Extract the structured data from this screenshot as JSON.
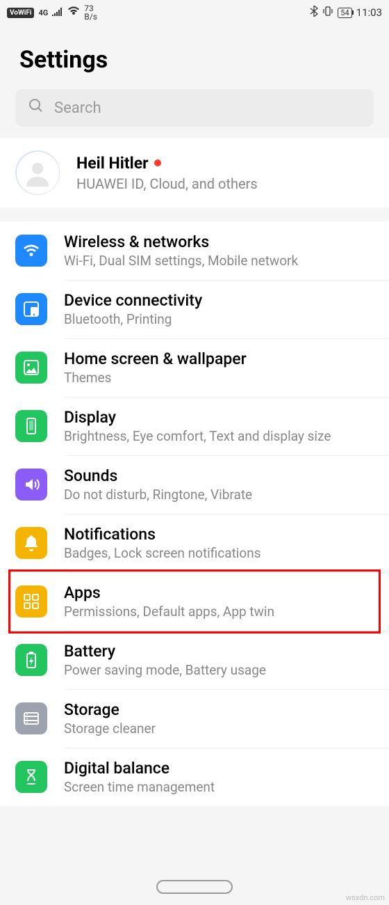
{
  "status": {
    "vowifi": "VoWiFi",
    "net": "4G",
    "speed_top": "73",
    "speed_bot": "B/s",
    "battery": "54",
    "time": "11:03"
  },
  "header": {
    "title": "Settings"
  },
  "search": {
    "placeholder": "Search"
  },
  "account": {
    "name": "Heil Hitler",
    "sub": "HUAWEI ID, Cloud, and others"
  },
  "items": [
    {
      "key": "wireless",
      "title": "Wireless & networks",
      "sub": "Wi-Fi, Dual SIM settings, Mobile network",
      "color": "#1e88ff"
    },
    {
      "key": "device-connectivity",
      "title": "Device connectivity",
      "sub": "Bluetooth, Printing",
      "color": "#1e88ff"
    },
    {
      "key": "home-screen",
      "title": "Home screen & wallpaper",
      "sub": "Themes",
      "color": "#22c55e"
    },
    {
      "key": "display",
      "title": "Display",
      "sub": "Brightness, Eye comfort, Text and display size",
      "color": "#22c55e"
    },
    {
      "key": "sounds",
      "title": "Sounds",
      "sub": "Do not disturb, Ringtone, Vibrate",
      "color": "#8b5cf6"
    },
    {
      "key": "notifications",
      "title": "Notifications",
      "sub": "Badges, Lock screen notifications",
      "color": "#f5b400"
    },
    {
      "key": "apps",
      "title": "Apps",
      "sub": "Permissions, Default apps, App twin",
      "color": "#f5b400",
      "highlighted": true
    },
    {
      "key": "battery",
      "title": "Battery",
      "sub": "Power saving mode, Battery usage",
      "color": "#22c55e"
    },
    {
      "key": "storage",
      "title": "Storage",
      "sub": "Storage cleaner",
      "color": "#9ca3af"
    },
    {
      "key": "digital-balance",
      "title": "Digital balance",
      "sub": "Screen time management",
      "color": "#22c55e"
    }
  ],
  "watermark": "wsxdn.com"
}
